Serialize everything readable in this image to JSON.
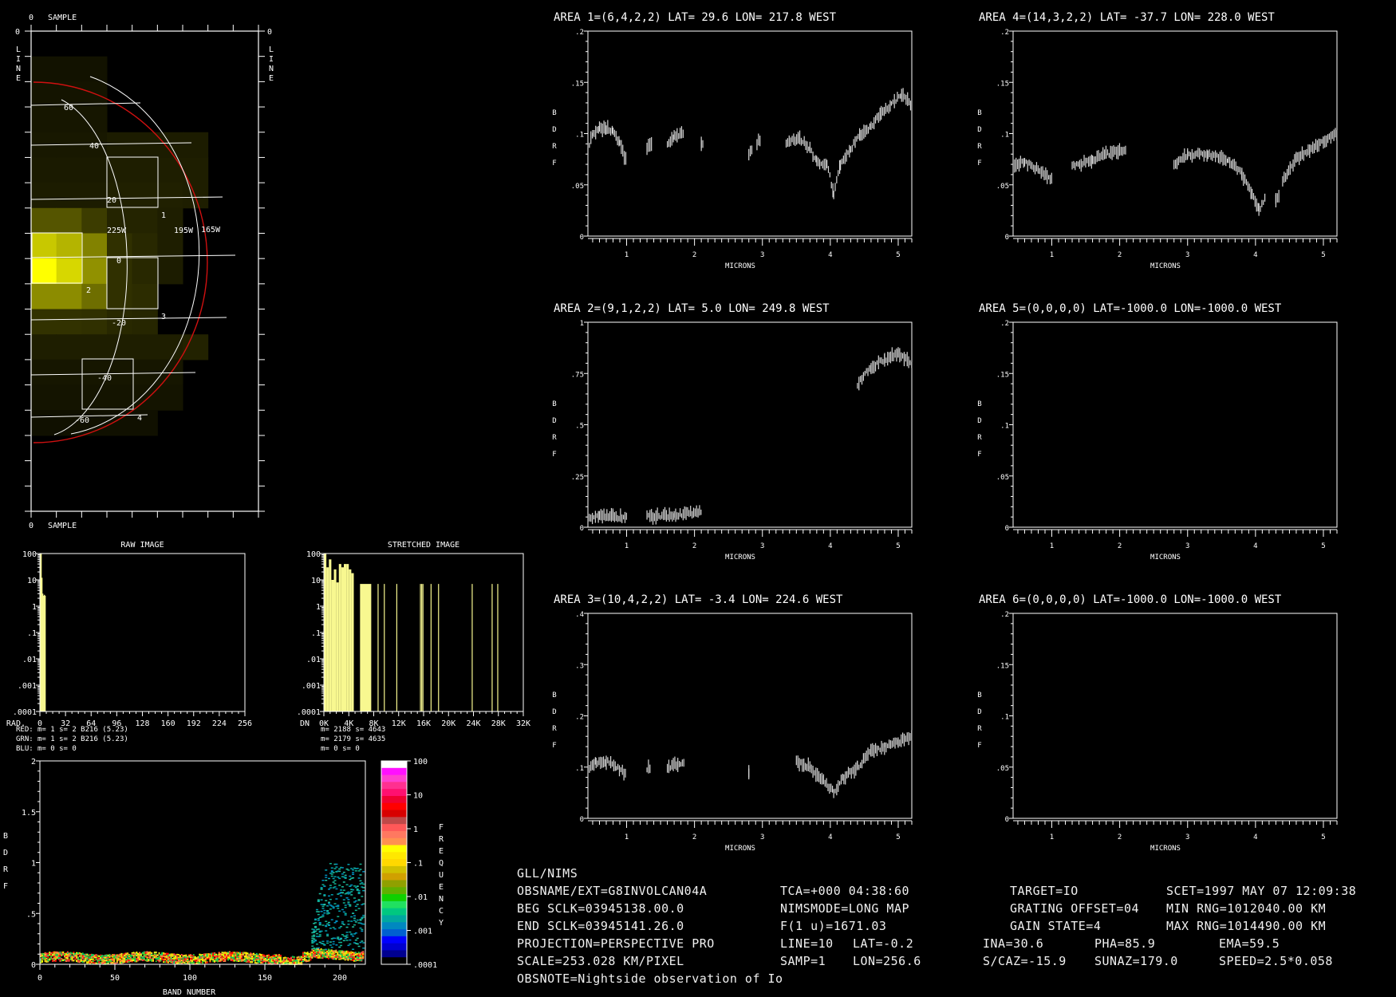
{
  "colors": {
    "background": "#000000",
    "frame": "#ffffff",
    "limb": "#d01010",
    "histogram": "#f8f890",
    "spectrum": "#d8d8d8",
    "red_label": "#e02020",
    "grn_label": "#e8e880",
    "blu_label": "#5050e0"
  },
  "map": {
    "top_label": "SAMPLE",
    "bottom_label": "SAMPLE",
    "side_label": "LINE",
    "zero": "0",
    "lat_labels": [
      "60",
      "40",
      "20",
      "0",
      "-20",
      "-40",
      "-60"
    ],
    "lon_labels": [
      "225W",
      "195W",
      "165W"
    ],
    "area_labels": [
      "1",
      "2",
      "3",
      "4"
    ],
    "cells": [
      [
        0,
        0,
        0,
        0,
        0,
        0,
        0,
        0,
        0
      ],
      [
        18,
        18,
        18,
        0,
        0,
        0,
        0,
        0,
        0
      ],
      [
        20,
        20,
        20,
        0,
        0,
        0,
        0,
        0,
        0
      ],
      [
        22,
        22,
        22,
        0,
        0,
        0,
        0,
        0,
        0
      ],
      [
        24,
        24,
        24,
        28,
        28,
        28,
        28,
        0,
        0
      ],
      [
        26,
        26,
        26,
        30,
        30,
        30,
        30,
        0,
        0
      ],
      [
        28,
        28,
        28,
        32,
        32,
        32,
        30,
        0,
        0
      ],
      [
        85,
        85,
        60,
        36,
        36,
        30,
        0,
        0,
        0
      ],
      [
        200,
        180,
        130,
        48,
        40,
        30,
        0,
        0,
        0
      ],
      [
        255,
        215,
        145,
        48,
        40,
        28,
        0,
        0,
        0
      ],
      [
        140,
        140,
        110,
        48,
        44,
        0,
        0,
        0,
        0
      ],
      [
        50,
        50,
        48,
        40,
        38,
        0,
        0,
        0,
        0
      ],
      [
        30,
        30,
        30,
        30,
        30,
        30,
        34,
        0,
        0
      ],
      [
        22,
        22,
        22,
        22,
        22,
        22,
        0,
        0,
        0
      ],
      [
        20,
        20,
        20,
        20,
        20,
        20,
        0,
        0,
        0
      ],
      [
        16,
        16,
        16,
        16,
        16,
        0,
        0,
        0,
        0
      ],
      [
        0,
        0,
        0,
        0,
        0,
        0,
        0,
        0,
        0
      ],
      [
        0,
        0,
        0,
        0,
        0,
        0,
        0,
        0,
        0
      ],
      [
        0,
        0,
        0,
        0,
        0,
        0,
        0,
        0,
        0
      ]
    ]
  },
  "raw_histogram": {
    "title": "RAW IMAGE",
    "xlabel": "RAD.",
    "x_ticks": [
      "0",
      "32",
      "64",
      "96",
      "128",
      "160",
      "192",
      "224",
      "256"
    ],
    "y_ticks": [
      "100",
      "10",
      "1",
      ".1",
      ".01",
      ".001",
      ".0001"
    ],
    "bars": [
      [
        0,
        100
      ],
      [
        1,
        100
      ],
      [
        2,
        12
      ],
      [
        3,
        3
      ],
      [
        4,
        2.5
      ],
      [
        5,
        2.7
      ],
      [
        6,
        2.5
      ]
    ]
  },
  "stretched_histogram": {
    "title": "STRETCHED IMAGE",
    "xlabel": "DN",
    "x_ticks": [
      "0K",
      "4K",
      "8K",
      "12K",
      "16K",
      "20K",
      "24K",
      "28K",
      "32K"
    ],
    "y_ticks": [
      "100",
      "10",
      "1",
      ".1",
      ".01",
      ".001",
      ".0001"
    ],
    "blocks": [
      [
        0,
        400,
        100
      ],
      [
        400,
        800,
        30
      ],
      [
        800,
        1200,
        60
      ],
      [
        1200,
        1600,
        10
      ],
      [
        1600,
        2000,
        25
      ],
      [
        2000,
        2400,
        8
      ],
      [
        2400,
        2800,
        40
      ],
      [
        2800,
        3200,
        30
      ],
      [
        3200,
        3600,
        40
      ],
      [
        3600,
        4000,
        40
      ],
      [
        4000,
        4400,
        25
      ],
      [
        4400,
        4800,
        18
      ],
      [
        5800,
        7600,
        7
      ]
    ],
    "lines": [
      [
        8700,
        7
      ],
      [
        9700,
        7
      ],
      [
        11700,
        7
      ],
      [
        15500,
        7
      ],
      [
        15700,
        7
      ],
      [
        15900,
        7
      ],
      [
        17200,
        7
      ],
      [
        18400,
        7
      ],
      [
        23800,
        7
      ],
      [
        27000,
        7
      ],
      [
        27900,
        7
      ]
    ]
  },
  "stats": {
    "red_label": "RED:",
    "grn_label": "GRN:",
    "blu_label": "BLU:",
    "red_raw": "m=    1 s=    2 B216 (5.23)",
    "grn_raw": "m=    1 s=    2 B216 (5.23)",
    "blu_raw": "m=    0 s=    0",
    "red_str": "m= 2188 s= 4643",
    "grn_str": "m= 2179 s= 4635",
    "blu_str": "m=    0 s=    0"
  },
  "density_plot": {
    "xlabel": "BAND NUMBER",
    "ylabel": "BDRF",
    "x_ticks": [
      "0",
      "50",
      "100",
      "150",
      "200"
    ],
    "y_ticks": [
      "0",
      ".5",
      "1",
      "1.5",
      "2"
    ],
    "xlim": [
      0,
      217
    ],
    "ylim": [
      0,
      2
    ]
  },
  "colorbar": {
    "label": "FREQUENCY",
    "ticks": [
      "100",
      "10",
      "1",
      ".1",
      ".01",
      ".001",
      ".0001"
    ],
    "colors": [
      "#ffffff",
      "#ff10ff",
      "#ff40d0",
      "#ff3090",
      "#ff1070",
      "#f00030",
      "#ff0000",
      "#d80000",
      "#c04848",
      "#ff5858",
      "#ff7860",
      "#ff9050",
      "#ffff00",
      "#ffe800",
      "#ffd800",
      "#d0c000",
      "#d0a000",
      "#90a000",
      "#60b000",
      "#10d000",
      "#20e060",
      "#00c880",
      "#00a8a0",
      "#0088c0",
      "#0060d0",
      "#0000ff",
      "#0000d0",
      "#000090",
      "#000000"
    ]
  },
  "chart_data": [
    {
      "type": "scatter",
      "title": "AREA 1=(6,4,2,2) LAT=  29.6 LON= 217.8 WEST",
      "xlabel": "MICRONS",
      "ylabel": "BDRF",
      "xlim": [
        0.43,
        5.2
      ],
      "ylim": [
        0,
        0.2
      ],
      "x_ticks": [
        "1",
        "2",
        "3",
        "4",
        "5"
      ],
      "y_ticks": [
        "0",
        ".05",
        ".1",
        ".15",
        ".2"
      ],
      "segments": [
        [
          [
            0.43,
            0.085
          ],
          [
            0.5,
            0.1
          ],
          [
            0.6,
            0.105
          ],
          [
            0.7,
            0.105
          ],
          [
            0.8,
            0.103
          ],
          [
            0.9,
            0.09
          ],
          [
            1.0,
            0.072
          ]
        ],
        [
          [
            1.3,
            0.087
          ],
          [
            1.38,
            0.09
          ]
        ],
        [
          [
            1.6,
            0.09
          ],
          [
            1.7,
            0.098
          ],
          [
            1.85,
            0.1
          ]
        ],
        [
          [
            2.1,
            0.09
          ],
          [
            2.13,
            0.091
          ]
        ],
        [
          [
            2.8,
            0.08
          ],
          [
            2.85,
            0.087
          ]
        ],
        [
          [
            2.92,
            0.09
          ],
          [
            2.97,
            0.095
          ]
        ],
        [
          [
            3.35,
            0.092
          ],
          [
            3.55,
            0.095
          ],
          [
            3.7,
            0.085
          ],
          [
            3.8,
            0.072
          ],
          [
            3.95,
            0.07
          ],
          [
            4.05,
            0.042
          ],
          [
            4.15,
            0.07
          ],
          [
            4.3,
            0.085
          ],
          [
            4.45,
            0.1
          ],
          [
            4.6,
            0.107
          ],
          [
            4.75,
            0.12
          ],
          [
            4.9,
            0.128
          ],
          [
            5.05,
            0.138
          ],
          [
            5.2,
            0.128
          ]
        ]
      ]
    },
    {
      "type": "scatter",
      "title": "AREA 2=(9,1,2,2) LAT=   5.0 LON= 249.8 WEST",
      "xlabel": "MICRONS",
      "ylabel": "BDRF",
      "xlim": [
        0.43,
        5.2
      ],
      "ylim": [
        0,
        1
      ],
      "x_ticks": [
        "1",
        "2",
        "3",
        "4",
        "5"
      ],
      "y_ticks": [
        "0",
        ".25",
        ".5",
        ".75",
        "1"
      ],
      "segments": [
        [
          [
            0.43,
            0.045
          ],
          [
            0.6,
            0.055
          ],
          [
            0.8,
            0.055
          ],
          [
            1.0,
            0.048
          ]
        ],
        [
          [
            1.3,
            0.05
          ],
          [
            1.7,
            0.06
          ],
          [
            2.1,
            0.075
          ]
        ],
        [
          [
            4.4,
            0.7
          ],
          [
            4.6,
            0.78
          ],
          [
            4.8,
            0.82
          ],
          [
            5.0,
            0.85
          ],
          [
            5.2,
            0.8
          ]
        ]
      ]
    },
    {
      "type": "scatter",
      "title": "AREA 3=(10,4,2,2) LAT=  -3.4 LON= 224.6 WEST",
      "xlabel": "MICRONS",
      "ylabel": "BDRF",
      "xlim": [
        0.43,
        5.2
      ],
      "ylim": [
        0,
        0.4
      ],
      "x_ticks": [
        "1",
        "2",
        "3",
        "4",
        "5"
      ],
      "y_ticks": [
        "0",
        ".1",
        ".2",
        ".3",
        ".4"
      ],
      "segments": [
        [
          [
            0.43,
            0.095
          ],
          [
            0.55,
            0.11
          ],
          [
            0.7,
            0.112
          ],
          [
            0.85,
            0.1
          ],
          [
            1.0,
            0.085
          ]
        ],
        [
          [
            1.3,
            0.095
          ],
          [
            1.35,
            0.1
          ]
        ],
        [
          [
            1.6,
            0.1
          ],
          [
            1.85,
            0.11
          ]
        ],
        [
          [
            2.8,
            0.09
          ],
          [
            2.82,
            0.092
          ]
        ],
        [
          [
            3.5,
            0.11
          ],
          [
            3.7,
            0.1
          ],
          [
            3.9,
            0.075
          ],
          [
            4.05,
            0.05
          ],
          [
            4.2,
            0.08
          ],
          [
            4.4,
            0.1
          ],
          [
            4.6,
            0.13
          ],
          [
            4.8,
            0.14
          ],
          [
            5.0,
            0.15
          ],
          [
            5.2,
            0.16
          ]
        ]
      ]
    },
    {
      "type": "scatter",
      "title": "AREA 4=(14,3,2,2) LAT= -37.7 LON= 228.0 WEST",
      "xlabel": "MICRONS",
      "ylabel": "BDRF",
      "xlim": [
        0.43,
        5.2
      ],
      "ylim": [
        0,
        0.2
      ],
      "x_ticks": [
        "1",
        "2",
        "3",
        "4",
        "5"
      ],
      "y_ticks": [
        "0",
        ".05",
        ".1",
        ".15",
        ".2"
      ],
      "segments": [
        [
          [
            0.43,
            0.07
          ],
          [
            0.6,
            0.072
          ],
          [
            0.8,
            0.065
          ],
          [
            1.0,
            0.055
          ]
        ],
        [
          [
            1.3,
            0.068
          ],
          [
            1.6,
            0.075
          ],
          [
            1.8,
            0.08
          ],
          [
            2.1,
            0.085
          ]
        ],
        [
          [
            2.8,
            0.07
          ],
          [
            3.0,
            0.08
          ],
          [
            3.3,
            0.08
          ],
          [
            3.6,
            0.075
          ],
          [
            3.8,
            0.06
          ],
          [
            3.95,
            0.04
          ],
          [
            4.05,
            0.025
          ],
          [
            4.15,
            0.04
          ]
        ],
        [
          [
            4.3,
            0.035
          ],
          [
            4.35,
            0.04
          ]
        ],
        [
          [
            4.4,
            0.055
          ],
          [
            4.6,
            0.075
          ],
          [
            4.8,
            0.085
          ],
          [
            5.0,
            0.092
          ],
          [
            5.2,
            0.1
          ]
        ]
      ]
    },
    {
      "type": "scatter",
      "title": "AREA 5=(0,0,0,0) LAT=-1000.0 LON=-1000.0 WEST",
      "xlabel": "MICRONS",
      "ylabel": "BDRF",
      "xlim": [
        0.43,
        5.2
      ],
      "ylim": [
        0,
        0.2
      ],
      "x_ticks": [
        "1",
        "2",
        "3",
        "4",
        "5"
      ],
      "y_ticks": [
        "0",
        ".05",
        ".1",
        ".15",
        ".2"
      ],
      "segments": []
    },
    {
      "type": "scatter",
      "title": "AREA 6=(0,0,0,0) LAT=-1000.0 LON=-1000.0 WEST",
      "xlabel": "MICRONS",
      "ylabel": "BDRF",
      "xlim": [
        0.43,
        5.2
      ],
      "ylim": [
        0,
        0.2
      ],
      "x_ticks": [
        "1",
        "2",
        "3",
        "4",
        "5"
      ],
      "y_ticks": [
        "0",
        ".05",
        ".1",
        ".15",
        ".2"
      ],
      "segments": []
    }
  ],
  "info": {
    "header": "GLL/NIMS",
    "obsname": "OBSNAME/EXT=G8INVOLCAN04A",
    "tca": "TCA=+000 04:38:60",
    "target": "TARGET=IO",
    "scet": "SCET=1997 MAY 07 12:09:38",
    "beg_sclk": "BEG SCLK=03945138.00.0",
    "nimsmode": "NIMSMODE=LONG MAP",
    "grating": "GRATING OFFSET=04",
    "min_rng": "MIN RNG=1012040.00 KM",
    "end_sclk": "END SCLK=03945141.26.0",
    "f1u": "F(1 u)=1671.03",
    "gain": "GAIN STATE=4",
    "max_rng": "MAX RNG=1014490.00 KM",
    "projection": "PROJECTION=PERSPECTIVE PRO",
    "line": "LINE=10",
    "lat": "LAT=-0.2",
    "ina": "INA=30.6",
    "pha": "PHA=85.9",
    "ema": "EMA=59.5",
    "scale": "SCALE=253.028 KM/PIXEL",
    "samp": "SAMP=1",
    "lon": "LON=256.6",
    "scaz": "S/CAZ=-15.9",
    "sunaz": "SUNAZ=179.0",
    "speed": "SPEED=2.5*0.058",
    "obsnote": "OBSNOTE=Nightside observation of Io"
  }
}
